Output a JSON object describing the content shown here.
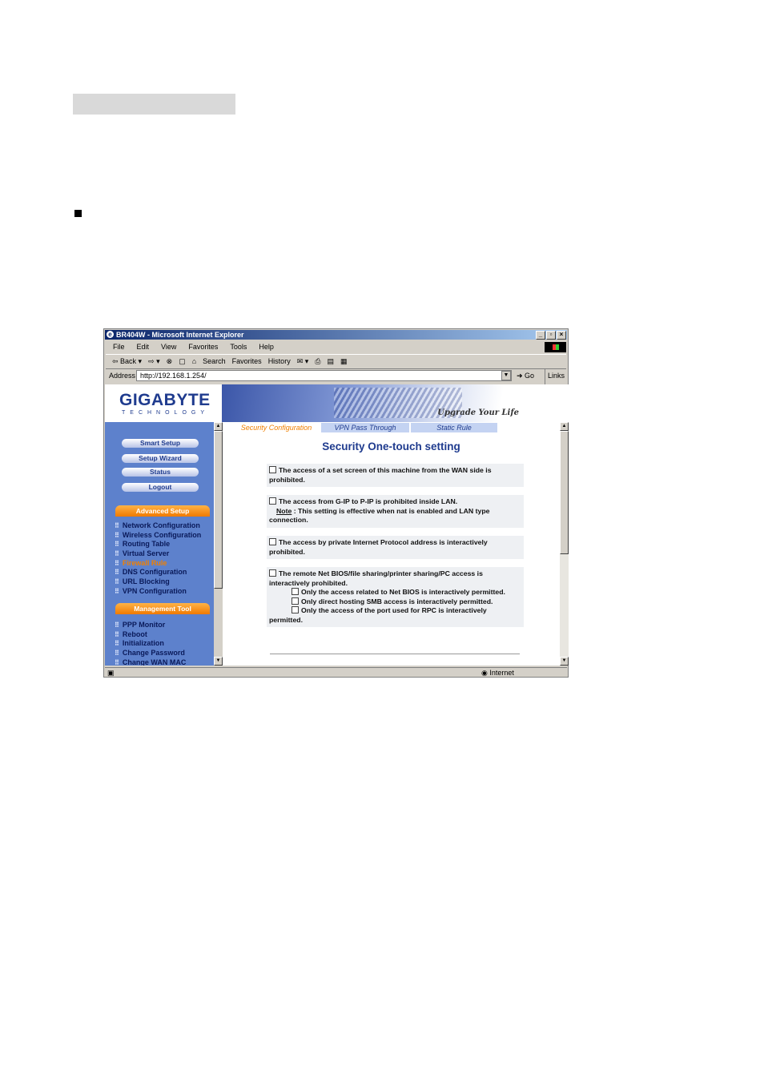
{
  "browser": {
    "title": "BR404W - Microsoft Internet Explorer",
    "menu": [
      "File",
      "Edit",
      "View",
      "Favorites",
      "Tools",
      "Help"
    ],
    "toolbar": [
      "⇦ Back ▾",
      "⇨ ▾",
      "⊗",
      "▢",
      "⌂",
      "Search",
      "Favorites",
      "History",
      "✉ ▾",
      "⎙",
      "▤",
      "▦"
    ],
    "address_label": "Address",
    "address": "http://192.168.1.254/",
    "go": "Go",
    "links": "Links »",
    "status_zone": "Internet"
  },
  "banner": {
    "logo": "GIGABYTE",
    "logo_sub": "TECHNOLOGY",
    "slogan": "Upgrade Your Life"
  },
  "sidebar": {
    "buttons": [
      "Smart Setup",
      "Setup Wizard",
      "Status",
      "Logout"
    ],
    "advanced_label": "Advanced Setup",
    "advanced": [
      "Network Configuration",
      "Wireless Configuration",
      "Routing Table",
      "Virtual Server",
      "Firewall Rule",
      "DNS Configuration",
      "URL Blocking",
      "VPN Configuration"
    ],
    "management_label": "Management Tool",
    "management": [
      "PPP Monitor",
      "Reboot",
      "Initialization",
      "Change Password",
      "Change WAN MAC"
    ]
  },
  "tabs": [
    "Security Configuration",
    "VPN Pass Through",
    "Static Rule"
  ],
  "heading": "Security  One-touch setting",
  "options": {
    "opt1": "The access of a set screen of this machine from the WAN side is prohibited.",
    "opt2": "The access from G-IP to P-IP is prohibited inside LAN.",
    "opt2_note_label": "Note",
    "opt2_note": " : This setting is effective when nat is enabled and LAN type connection.",
    "opt3": "The access by private Internet Protocol address is interactively prohibited.",
    "opt4": "The remote Net BIOS/file sharing/printer sharing/PC access is interactively prohibited.",
    "opt4a": "Only the access related to Net BIOS is interactively permitted.",
    "opt4b": "Only direct hosting SMB access is interactively permitted.",
    "opt4c": "Only the access of the port used for RPC is interactively permitted."
  }
}
